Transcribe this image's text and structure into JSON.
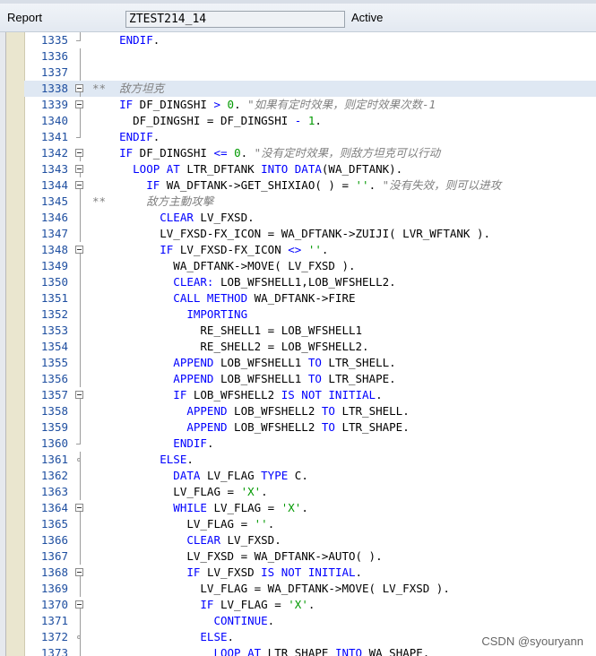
{
  "header": {
    "report_label": "Report",
    "program_name": "ZTEST214_14",
    "status": "Active"
  },
  "watermark": "CSDN @syouryann",
  "lines": [
    {
      "n": "1335",
      "tokens": [
        {
          "t": "k",
          "v": "    ENDIF"
        },
        {
          "t": "n",
          "v": "."
        }
      ]
    },
    {
      "n": "1336",
      "tokens": []
    },
    {
      "n": "1337",
      "tokens": []
    },
    {
      "n": "1338",
      "tokens": [
        {
          "t": "c",
          "v": "**  敌方坦克"
        }
      ]
    },
    {
      "n": "1339",
      "tokens": [
        {
          "t": "k",
          "v": "    IF"
        },
        {
          "t": "n",
          "v": " DF_DINGSHI "
        },
        {
          "t": "k",
          "v": ">"
        },
        {
          "t": "n",
          "v": " "
        },
        {
          "t": "s",
          "v": "0"
        },
        {
          "t": "n",
          "v": ". "
        },
        {
          "t": "c",
          "v": "\"如果有定时效果，则定时效果次数-1"
        }
      ]
    },
    {
      "n": "1340",
      "tokens": [
        {
          "t": "n",
          "v": "      DF_DINGSHI = DF_DINGSHI "
        },
        {
          "t": "k",
          "v": "-"
        },
        {
          "t": "n",
          "v": " "
        },
        {
          "t": "s",
          "v": "1"
        },
        {
          "t": "n",
          "v": "."
        }
      ]
    },
    {
      "n": "1341",
      "tokens": [
        {
          "t": "k",
          "v": "    ENDIF"
        },
        {
          "t": "n",
          "v": "."
        }
      ]
    },
    {
      "n": "1342",
      "tokens": [
        {
          "t": "k",
          "v": "    IF"
        },
        {
          "t": "n",
          "v": " DF_DINGSHI "
        },
        {
          "t": "k",
          "v": "<="
        },
        {
          "t": "n",
          "v": " "
        },
        {
          "t": "s",
          "v": "0"
        },
        {
          "t": "n",
          "v": ". "
        },
        {
          "t": "c",
          "v": "\"没有定时效果，则敌方坦克可以行动"
        }
      ]
    },
    {
      "n": "1343",
      "tokens": [
        {
          "t": "k",
          "v": "      LOOP AT"
        },
        {
          "t": "n",
          "v": " LTR_DFTANK "
        },
        {
          "t": "k",
          "v": "INTO DATA"
        },
        {
          "t": "n",
          "v": "(WA_DFTANK)."
        }
      ]
    },
    {
      "n": "1344",
      "tokens": [
        {
          "t": "k",
          "v": "        IF"
        },
        {
          "t": "n",
          "v": " WA_DFTANK->GET_SHIXIAO( ) = "
        },
        {
          "t": "s",
          "v": "''"
        },
        {
          "t": "n",
          "v": ". "
        },
        {
          "t": "c",
          "v": "\"没有失效，则可以进攻"
        }
      ]
    },
    {
      "n": "1345",
      "tokens": [
        {
          "t": "c",
          "v": "**      敌方主動攻擊"
        }
      ]
    },
    {
      "n": "1346",
      "tokens": [
        {
          "t": "k",
          "v": "          CLEAR"
        },
        {
          "t": "n",
          "v": " LV_FXSD."
        }
      ]
    },
    {
      "n": "1347",
      "tokens": [
        {
          "t": "n",
          "v": "          LV_FXSD-FX_ICON = WA_DFTANK->ZUIJI( LVR_WFTANK )."
        }
      ]
    },
    {
      "n": "1348",
      "tokens": [
        {
          "t": "k",
          "v": "          IF"
        },
        {
          "t": "n",
          "v": " LV_FXSD-FX_ICON "
        },
        {
          "t": "k",
          "v": "<>"
        },
        {
          "t": "n",
          "v": " "
        },
        {
          "t": "s",
          "v": "''"
        },
        {
          "t": "n",
          "v": "."
        }
      ]
    },
    {
      "n": "1349",
      "tokens": [
        {
          "t": "n",
          "v": "            WA_DFTANK->MOVE( LV_FXSD )."
        }
      ]
    },
    {
      "n": "1350",
      "tokens": [
        {
          "t": "k",
          "v": "            CLEAR:"
        },
        {
          "t": "n",
          "v": " LOB_WFSHELL1,LOB_WFSHELL2."
        }
      ]
    },
    {
      "n": "1351",
      "tokens": [
        {
          "t": "k",
          "v": "            CALL METHOD"
        },
        {
          "t": "n",
          "v": " WA_DFTANK->FIRE"
        }
      ]
    },
    {
      "n": "1352",
      "tokens": [
        {
          "t": "k",
          "v": "              IMPORTING"
        }
      ]
    },
    {
      "n": "1353",
      "tokens": [
        {
          "t": "n",
          "v": "                RE_SHELL1 = LOB_WFSHELL1"
        }
      ]
    },
    {
      "n": "1354",
      "tokens": [
        {
          "t": "n",
          "v": "                RE_SHELL2 = LOB_WFSHELL2."
        }
      ]
    },
    {
      "n": "1355",
      "tokens": [
        {
          "t": "k",
          "v": "            APPEND"
        },
        {
          "t": "n",
          "v": " LOB_WFSHELL1 "
        },
        {
          "t": "k",
          "v": "TO"
        },
        {
          "t": "n",
          "v": " LTR_SHELL."
        }
      ]
    },
    {
      "n": "1356",
      "tokens": [
        {
          "t": "k",
          "v": "            APPEND"
        },
        {
          "t": "n",
          "v": " LOB_WFSHELL1 "
        },
        {
          "t": "k",
          "v": "TO"
        },
        {
          "t": "n",
          "v": " LTR_SHAPE."
        }
      ]
    },
    {
      "n": "1357",
      "tokens": [
        {
          "t": "k",
          "v": "            IF"
        },
        {
          "t": "n",
          "v": " LOB_WFSHELL2 "
        },
        {
          "t": "k",
          "v": "IS NOT INITIAL"
        },
        {
          "t": "n",
          "v": "."
        }
      ]
    },
    {
      "n": "1358",
      "tokens": [
        {
          "t": "k",
          "v": "              APPEND"
        },
        {
          "t": "n",
          "v": " LOB_WFSHELL2 "
        },
        {
          "t": "k",
          "v": "TO"
        },
        {
          "t": "n",
          "v": " LTR_SHELL."
        }
      ]
    },
    {
      "n": "1359",
      "tokens": [
        {
          "t": "k",
          "v": "              APPEND"
        },
        {
          "t": "n",
          "v": " LOB_WFSHELL2 "
        },
        {
          "t": "k",
          "v": "TO"
        },
        {
          "t": "n",
          "v": " LTR_SHAPE."
        }
      ]
    },
    {
      "n": "1360",
      "tokens": [
        {
          "t": "k",
          "v": "            ENDIF"
        },
        {
          "t": "n",
          "v": "."
        }
      ]
    },
    {
      "n": "1361",
      "tokens": [
        {
          "t": "k",
          "v": "          ELSE"
        },
        {
          "t": "n",
          "v": "."
        }
      ]
    },
    {
      "n": "1362",
      "tokens": [
        {
          "t": "k",
          "v": "            DATA"
        },
        {
          "t": "n",
          "v": " LV_FLAG "
        },
        {
          "t": "k",
          "v": "TYPE"
        },
        {
          "t": "n",
          "v": " C."
        }
      ]
    },
    {
      "n": "1363",
      "tokens": [
        {
          "t": "n",
          "v": "            LV_FLAG = "
        },
        {
          "t": "s",
          "v": "'X'"
        },
        {
          "t": "n",
          "v": "."
        }
      ]
    },
    {
      "n": "1364",
      "tokens": [
        {
          "t": "k",
          "v": "            WHILE"
        },
        {
          "t": "n",
          "v": " LV_FLAG = "
        },
        {
          "t": "s",
          "v": "'X'"
        },
        {
          "t": "n",
          "v": "."
        }
      ]
    },
    {
      "n": "1365",
      "tokens": [
        {
          "t": "n",
          "v": "              LV_FLAG = "
        },
        {
          "t": "s",
          "v": "''"
        },
        {
          "t": "n",
          "v": "."
        }
      ]
    },
    {
      "n": "1366",
      "tokens": [
        {
          "t": "k",
          "v": "              CLEAR"
        },
        {
          "t": "n",
          "v": " LV_FXSD."
        }
      ]
    },
    {
      "n": "1367",
      "tokens": [
        {
          "t": "n",
          "v": "              LV_FXSD = WA_DFTANK->AUTO( )."
        }
      ]
    },
    {
      "n": "1368",
      "tokens": [
        {
          "t": "k",
          "v": "              IF"
        },
        {
          "t": "n",
          "v": " LV_FXSD "
        },
        {
          "t": "k",
          "v": "IS NOT INITIAL"
        },
        {
          "t": "n",
          "v": "."
        }
      ]
    },
    {
      "n": "1369",
      "tokens": [
        {
          "t": "n",
          "v": "                LV_FLAG = WA_DFTANK->MOVE( LV_FXSD )."
        }
      ]
    },
    {
      "n": "1370",
      "tokens": [
        {
          "t": "k",
          "v": "                IF"
        },
        {
          "t": "n",
          "v": " LV_FLAG = "
        },
        {
          "t": "s",
          "v": "'X'"
        },
        {
          "t": "n",
          "v": "."
        }
      ]
    },
    {
      "n": "1371",
      "tokens": [
        {
          "t": "k",
          "v": "                  CONTINUE"
        },
        {
          "t": "n",
          "v": "."
        }
      ]
    },
    {
      "n": "1372",
      "tokens": [
        {
          "t": "k",
          "v": "                ELSE"
        },
        {
          "t": "n",
          "v": "."
        }
      ]
    },
    {
      "n": "1373",
      "tokens": [
        {
          "t": "k",
          "v": "                  LOOP AT"
        },
        {
          "t": "n",
          "v": " LTR_SHAPE "
        },
        {
          "t": "k",
          "v": "INTO"
        },
        {
          "t": "n",
          "v": " WA_SHAPE."
        }
      ]
    }
  ]
}
